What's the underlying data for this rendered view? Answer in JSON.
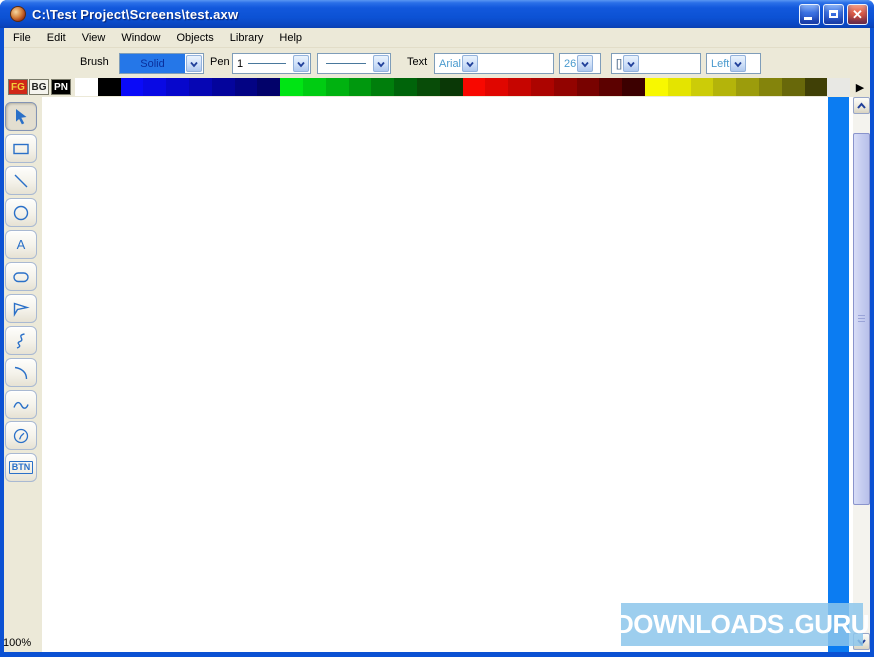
{
  "window": {
    "title": "C:\\Test Project\\Screens\\test.axw",
    "controls": {
      "minimize": "minimize",
      "maximize": "maximize",
      "close": "close"
    }
  },
  "menu": {
    "items": [
      "File",
      "Edit",
      "View",
      "Window",
      "Objects",
      "Library",
      "Help"
    ]
  },
  "toolbar": {
    "brush_label": "Brush",
    "brush_value": "Solid",
    "pen_label": "Pen",
    "pen_size_value": "1",
    "text_label": "Text",
    "font_value": "Arial",
    "font_size_value": "26",
    "symbol_value": "[]",
    "align_value": "Left"
  },
  "palette": {
    "fg_label": "FG",
    "bg_label": "BG",
    "pn_label": "PN",
    "more_arrow": "▶",
    "colors": [
      "#ffffff",
      "#000000",
      "#0a0af8",
      "#0909e4",
      "#0707cc",
      "#0606b4",
      "#04049c",
      "#030384",
      "#02026a",
      "#00e414",
      "#00cc12",
      "#00b210",
      "#00980e",
      "#007e0c",
      "#00640a",
      "#084c08",
      "#0a3806",
      "#f80800",
      "#e00600",
      "#c60500",
      "#ac0400",
      "#920300",
      "#780200",
      "#5c0100",
      "#3c0000",
      "#f8f800",
      "#e4e400",
      "#cccc08",
      "#b4b40a",
      "#9c9c0c",
      "#84840c",
      "#68680a",
      "#404006",
      "#e8e8e4"
    ]
  },
  "tools": [
    {
      "id": "select",
      "name": "selection-tool",
      "selected": true
    },
    {
      "id": "rectangle",
      "name": "rectangle-tool",
      "selected": false
    },
    {
      "id": "line",
      "name": "line-tool",
      "selected": false
    },
    {
      "id": "ellipse",
      "name": "ellipse-tool",
      "selected": false
    },
    {
      "id": "text",
      "name": "text-tool",
      "selected": false,
      "label": "A"
    },
    {
      "id": "rounded-rectangle",
      "name": "rounded-rectangle-tool",
      "selected": false
    },
    {
      "id": "polygon",
      "name": "polygon-tool",
      "selected": false
    },
    {
      "id": "polyline",
      "name": "polyline-tool",
      "selected": false
    },
    {
      "id": "arc",
      "name": "arc-tool",
      "selected": false
    },
    {
      "id": "curve",
      "name": "curve-tool",
      "selected": false
    },
    {
      "id": "clock",
      "name": "clock-tool",
      "selected": false
    },
    {
      "id": "button",
      "name": "button-tool",
      "selected": false,
      "label": "BTN"
    }
  ],
  "statusbar": {
    "zoom_level": "100%"
  },
  "watermark": {
    "text_left": "DOWNLOADS",
    "text_right": ".GURU"
  },
  "colors": {
    "titlebar_blue": "#0c52d4",
    "panel_beige": "#ece9d8",
    "canvas_white": "#ffffff",
    "edge_strip_blue": "#0b7cf2",
    "tool_icon_blue": "#2a70c8",
    "brush_highlight": "#2577e8"
  }
}
